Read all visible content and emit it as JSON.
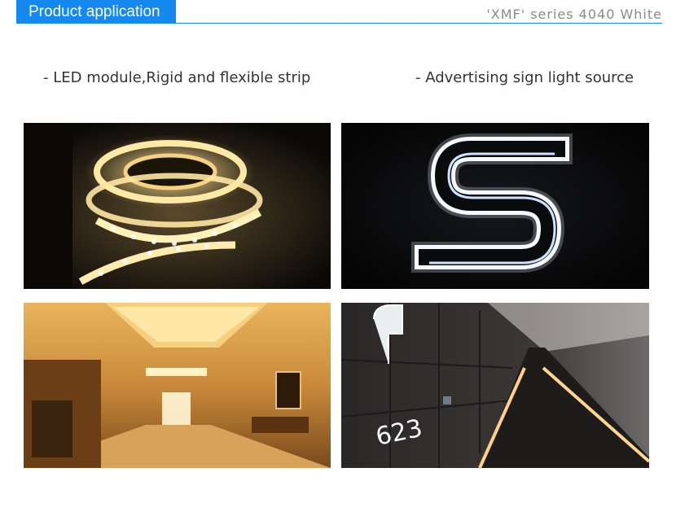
{
  "header": {
    "tab_label": "Product application",
    "series": "'XMF' series 4040 White",
    "accent_color": "#1589f0"
  },
  "applications": {
    "left": "- LED module,Rigid and flexible strip",
    "right": "- Advertising sign light source"
  },
  "photos": {
    "led_strip_reel": {
      "subject": "glowing warm-white LED strip reel"
    },
    "channel_letter": {
      "subject": "illuminated white S channel letter"
    },
    "hotel_lobby": {
      "subject": "warm-lit hotel corridor with cove lighting"
    },
    "hallway": {
      "subject": "dark hallway with floor LED lines",
      "room_number": "623"
    }
  }
}
